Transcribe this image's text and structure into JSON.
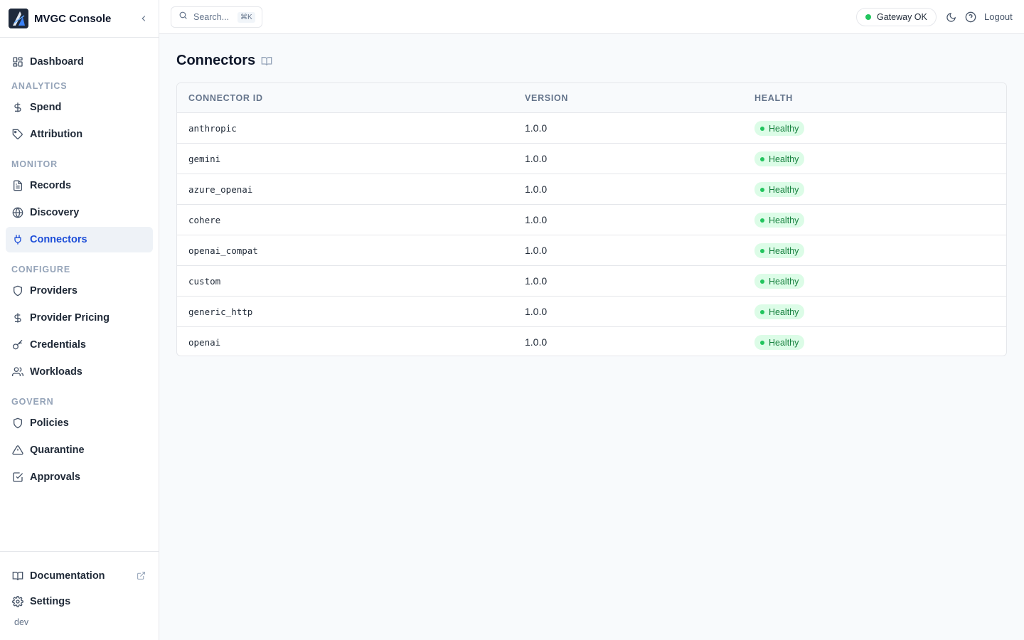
{
  "app": {
    "title": "MVGC Console",
    "env": "dev"
  },
  "search": {
    "placeholder": "Search...",
    "shortcut": "⌘K"
  },
  "topbar": {
    "gateway_status": "Gateway OK",
    "logout_label": "Logout",
    "status_color": "#22c55e"
  },
  "sidebar": {
    "dashboard": "Dashboard",
    "sections": {
      "analytics": "ANALYTICS",
      "monitor": "MONITOR",
      "configure": "CONFIGURE",
      "govern": "GOVERN"
    },
    "items": {
      "spend": "Spend",
      "attribution": "Attribution",
      "records": "Records",
      "discovery": "Discovery",
      "connectors": "Connectors",
      "providers": "Providers",
      "provider_pricing": "Provider Pricing",
      "credentials": "Credentials",
      "workloads": "Workloads",
      "policies": "Policies",
      "quarantine": "Quarantine",
      "approvals": "Approvals"
    },
    "active": "connectors",
    "bottom": {
      "documentation": "Documentation",
      "settings": "Settings"
    },
    "accent_color": "#1d4ed8"
  },
  "page": {
    "title": "Connectors"
  },
  "table": {
    "columns": [
      "CONNECTOR ID",
      "VERSION",
      "HEALTH"
    ],
    "rows": [
      {
        "id": "anthropic",
        "version": "1.0.0",
        "health": "Healthy"
      },
      {
        "id": "gemini",
        "version": "1.0.0",
        "health": "Healthy"
      },
      {
        "id": "azure_openai",
        "version": "1.0.0",
        "health": "Healthy"
      },
      {
        "id": "cohere",
        "version": "1.0.0",
        "health": "Healthy"
      },
      {
        "id": "openai_compat",
        "version": "1.0.0",
        "health": "Healthy"
      },
      {
        "id": "custom",
        "version": "1.0.0",
        "health": "Healthy"
      },
      {
        "id": "generic_http",
        "version": "1.0.0",
        "health": "Healthy"
      },
      {
        "id": "openai",
        "version": "1.0.0",
        "health": "Healthy"
      }
    ],
    "health_color": "#15803d"
  },
  "icons": {
    "brand": "logo-icon",
    "collapse": "chevron-left-icon",
    "search": "search-icon",
    "theme": "moon-icon",
    "help": "help-circle-icon",
    "doc": "book-icon"
  }
}
